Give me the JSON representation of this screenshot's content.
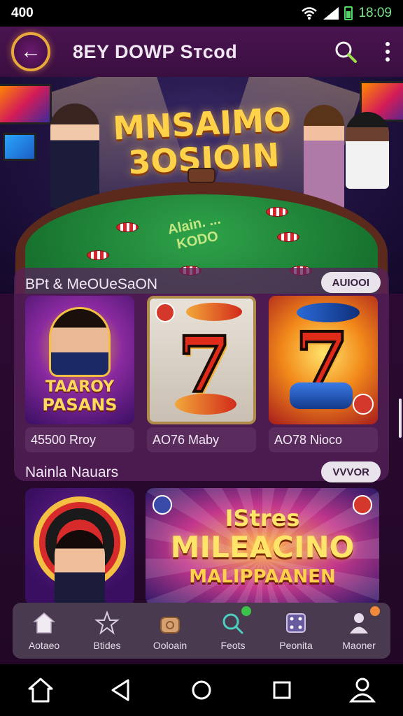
{
  "status_bar": {
    "left_text": "400",
    "time": "18:09"
  },
  "header": {
    "title": "8EY DOWP Sтcod"
  },
  "hero": {
    "title_line1": "MNSAIMO",
    "title_line2": "3OSIOIN",
    "felt_text": "Alain. ... KODO"
  },
  "section1": {
    "title": "BPt & MeOUeSaON",
    "action": "AUIOOI",
    "games": [
      {
        "art_text_1": "TAAROY",
        "art_text_2": "PASANS",
        "label": "45500 Rroy"
      },
      {
        "label": "AO76 Maby"
      },
      {
        "label": "AO78 Nioco"
      }
    ]
  },
  "section2": {
    "title": "Nainla Nauars",
    "action": "VVVOR",
    "banner_line1": "IStres",
    "banner_line2": "MILEACINO",
    "banner_line3": "MALIPPAANEN"
  },
  "bottom_nav": [
    {
      "label": "Aotaeo",
      "icon": "home-icon"
    },
    {
      "label": "Btides",
      "icon": "star-icon"
    },
    {
      "label": "Ooloain",
      "icon": "bag-icon"
    },
    {
      "label": "Feots",
      "icon": "search-icon"
    },
    {
      "label": "Peonita",
      "icon": "dice-icon"
    },
    {
      "label": "Maoner",
      "icon": "profile-icon"
    }
  ],
  "colors": {
    "accent_gold": "#e8a93a",
    "bg_purple": "#3b0f3c",
    "search_green": "#9be04a"
  }
}
